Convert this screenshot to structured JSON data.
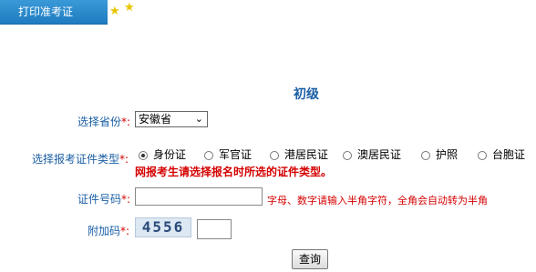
{
  "tab": {
    "label": "打印准考证"
  },
  "icons": {
    "star1": "star-icon",
    "star2": "star-icon"
  },
  "title": "初级",
  "province": {
    "label": "选择省份",
    "required_mark": "*:",
    "value": "安徽省"
  },
  "id_type": {
    "label": "选择报考证件类型",
    "required_mark": "*:",
    "options": [
      "身份证",
      "军官证",
      "港居民证",
      "澳居民证",
      "护照",
      "台胞证"
    ],
    "selected": "身份证",
    "notice": "网报考生请选择报名时所选的证件类型。"
  },
  "id_number": {
    "label": "证件号码",
    "required_mark": "*:",
    "value": "",
    "hint": "字母、数字请输入半角字符，全角会自动转为半角"
  },
  "captcha": {
    "label": "附加码",
    "required_mark": "*:",
    "image_text": "4556",
    "value": ""
  },
  "submit": {
    "label": "查询"
  },
  "colors": {
    "tab_bg": "#1e7bc0",
    "label": "#1b5fa5",
    "required": "#d40000"
  }
}
